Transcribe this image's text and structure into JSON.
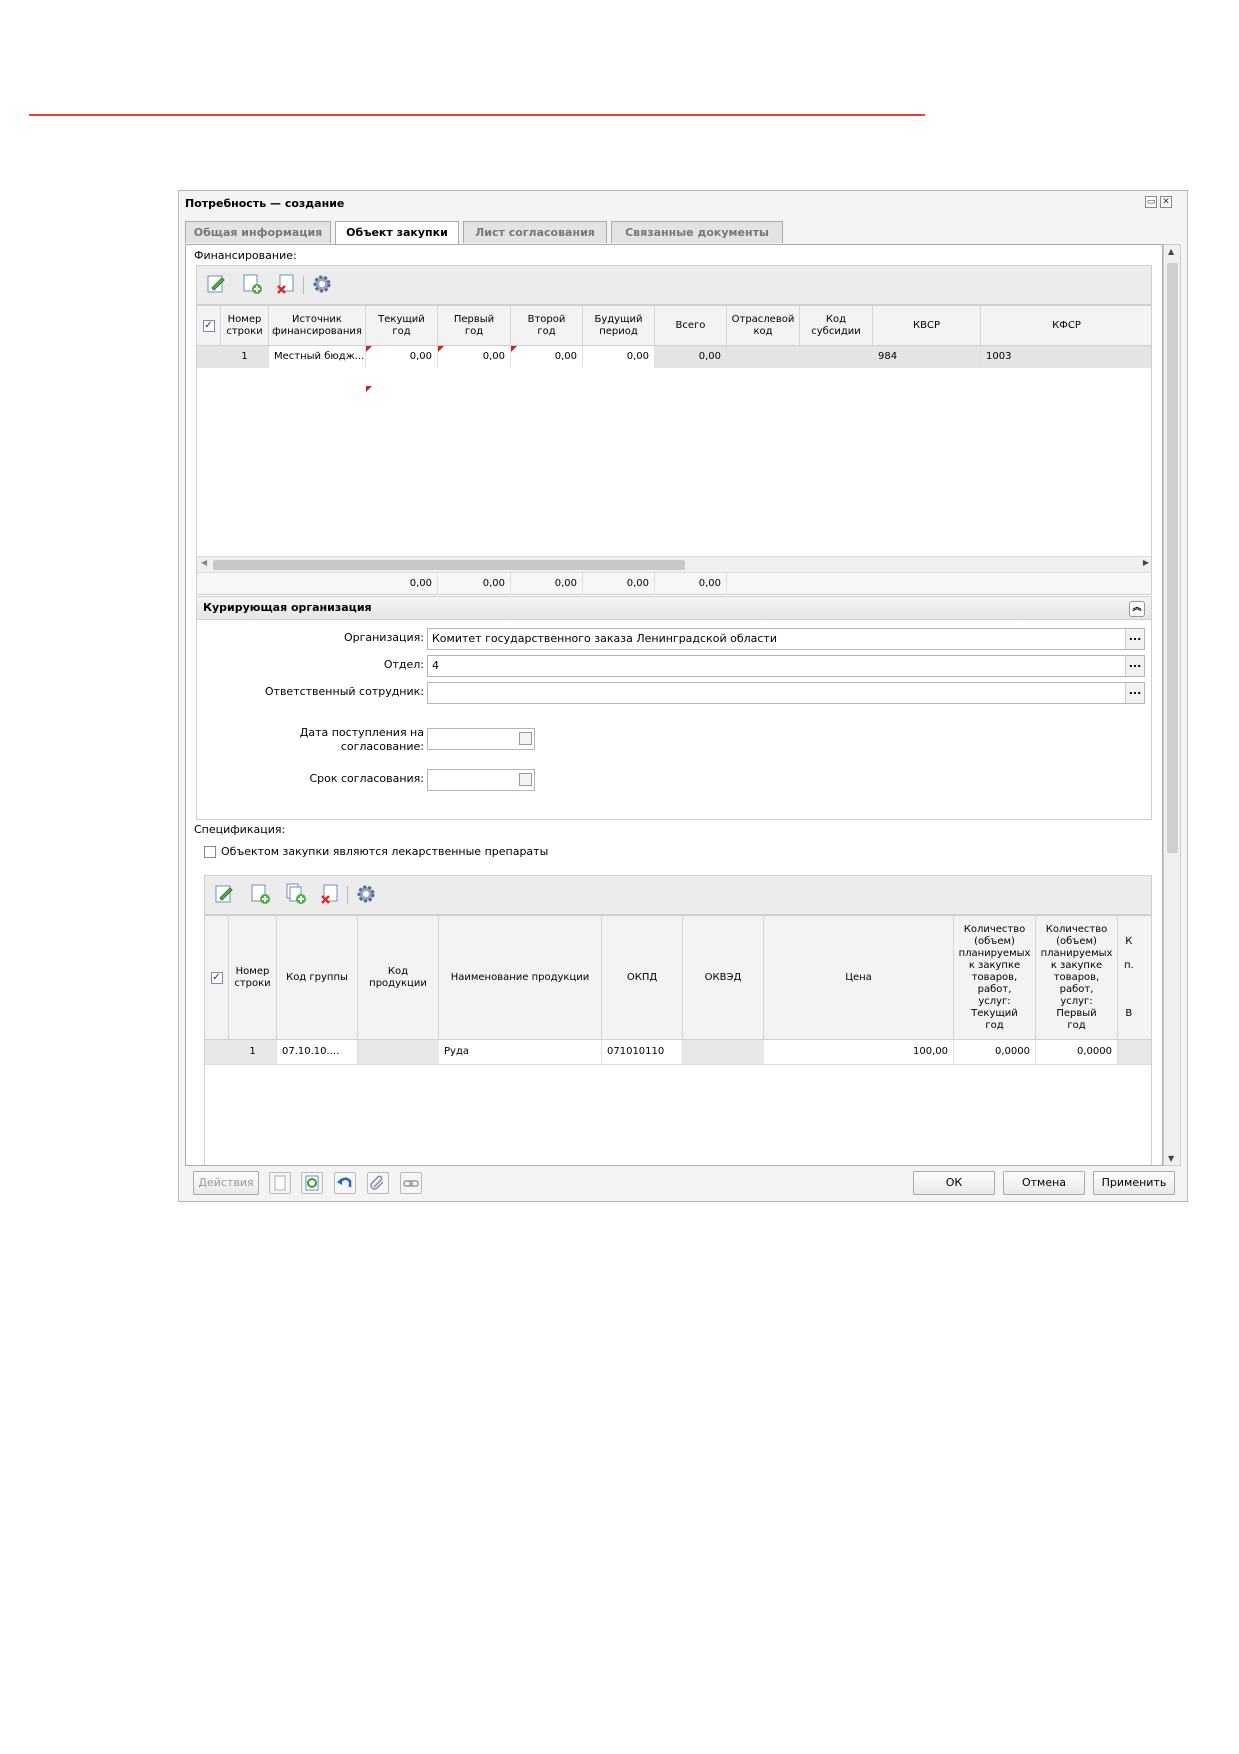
{
  "window": {
    "title": "Потребность — создание"
  },
  "tabs": [
    {
      "label": "Общая информация"
    },
    {
      "label": "Объект закупки"
    },
    {
      "label": "Лист согласования"
    },
    {
      "label": "Связанные документы"
    }
  ],
  "financing": {
    "label": "Финансирование:",
    "headers": [
      "Номер\nстроки",
      "Источник\nфинансирования",
      "Текущий\nгод",
      "Первый\nгод",
      "Второй\nгод",
      "Будущий\nпериод",
      "Всего",
      "Отраслевой\nкод",
      "Код\nсубсидии",
      "КВСР",
      "КФСР"
    ],
    "row": {
      "checked": true,
      "num": "1",
      "source": "Местный бюдж...",
      "current": "0,00",
      "first": "0,00",
      "second": "0,00",
      "future": "0,00",
      "total": "0,00",
      "industry": "",
      "subsidy": "",
      "kvsr": "984",
      "kfsr": "1003"
    },
    "totals": {
      "current": "0,00",
      "first": "0,00",
      "second": "0,00",
      "future": "0,00",
      "total": "0,00"
    }
  },
  "curator": {
    "title": "Курирующая организация",
    "org_label": "Организация:",
    "org_value": "Комитет государственного заказа Ленинградской области",
    "dept_label": "Отдел:",
    "dept_value": "4",
    "employee_label": "Ответственный сотрудник:",
    "employee_value": "",
    "date_label": "Дата поступления на\nсогласование:",
    "term_label": "Срок согласования:"
  },
  "spec": {
    "label": "Спецификация:",
    "medicine_checkbox_label": "Объектом закупки являются лекарственные препараты",
    "medicine_checked": false,
    "headers": [
      "Номер\nстроки",
      "Код группы",
      "Код\nпродукции",
      "Наименование продукции",
      "ОКПД",
      "ОКВЭД",
      "Цена",
      "Количество\n(объем)\nпланируемых\nк закупке\nтоваров,\nработ,\nуслуг:\nТекущий\nгод",
      "Количество\n(объем)\nпланируемых\nк закупке\nтоваров,\nработ,\nуслуг:\nПервый\nгод",
      "К\n\nп.\n\n\n\nВ"
    ],
    "row": {
      "checked": true,
      "num": "1",
      "group": "07.10.10....",
      "product_code": "",
      "name": "Руда",
      "okpd": "071010110",
      "okved": "",
      "price": "100,00",
      "qty_current": "0,0000",
      "qty_first": "0,0000"
    }
  },
  "footer": {
    "actions": "Действия",
    "ok": "ОК",
    "cancel": "Отмена",
    "apply": "Применить"
  },
  "dots": "..."
}
